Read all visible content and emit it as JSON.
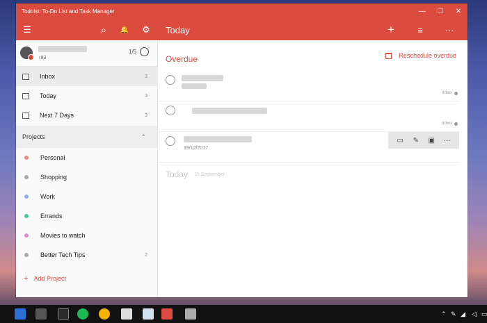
{
  "window": {
    "title": "Todoist: To-Do List and Task Manager",
    "minimize": "—",
    "maximize": "☐",
    "close": "✕"
  },
  "toolbar": {
    "menu_icon": "☰",
    "search_icon": "⌕",
    "bell_icon": "🔔",
    "gear_icon": "⚙",
    "title": "Today",
    "add_icon": "+",
    "sort_icon": "≡",
    "more_icon": "···"
  },
  "profile": {
    "karma": "↑83",
    "progress": "1/5"
  },
  "nav": [
    {
      "label": "Inbox",
      "count": "3"
    },
    {
      "label": "Today",
      "count": "3"
    },
    {
      "label": "Next 7 Days",
      "count": "3"
    }
  ],
  "projects_header": {
    "label": "Projects",
    "chevron": "⌃"
  },
  "projects": [
    {
      "label": "Personal",
      "color": "#f08a7a",
      "count": ""
    },
    {
      "label": "Shopping",
      "color": "#a8a8a8",
      "count": ""
    },
    {
      "label": "Work",
      "color": "#8ab4e8",
      "count": ""
    },
    {
      "label": "Errands",
      "color": "#4bc7a0",
      "count": ""
    },
    {
      "label": "Movies to watch",
      "color": "#e08ad8",
      "count": ""
    },
    {
      "label": "Better Tech Tips",
      "color": "#a8a8a8",
      "count": "2"
    }
  ],
  "add_project": {
    "plus": "+",
    "label": "Add Project"
  },
  "overdue": {
    "title": "Overdue",
    "reschedule": "Reschedule overdue"
  },
  "tasks": [
    {
      "project": "Inbox",
      "date": ""
    },
    {
      "project": "Inbox",
      "date": ""
    },
    {
      "project": "",
      "date": "19/12/2017"
    }
  ],
  "task_actions": {
    "comment": "▭",
    "edit": "✎",
    "schedule": "▣",
    "more": "···"
  },
  "today_section": {
    "title": "Today",
    "subtitle": "15 September"
  }
}
